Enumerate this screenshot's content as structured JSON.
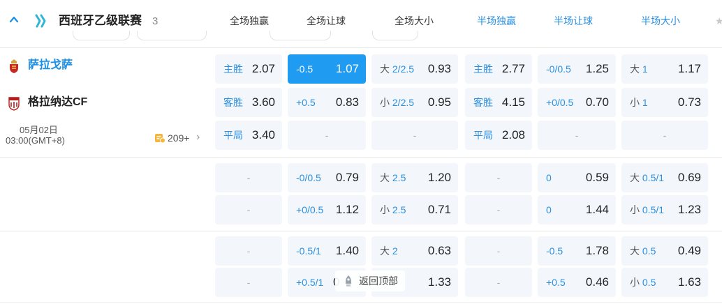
{
  "league": {
    "name": "西班牙乙级联赛",
    "count": "3"
  },
  "columns": [
    "全场独赢",
    "全场让球",
    "全场大小",
    "半场独赢",
    "半场让球",
    "半场大小"
  ],
  "match": {
    "home": "萨拉戈萨",
    "away": "格拉纳达CF",
    "date": "05月02日",
    "time": "03:00(GMT+8)",
    "more_count": "209+"
  },
  "odds": {
    "r1": {
      "c1": {
        "lbl": "主胜",
        "val": "2.07"
      },
      "c2": {
        "lbl": "-0.5",
        "val": "1.07"
      },
      "c3": {
        "pre": "大",
        "lbl": "2/2.5",
        "val": "0.93"
      },
      "c4": {
        "lbl": "主胜",
        "val": "2.77"
      },
      "c5": {
        "lbl": "-0/0.5",
        "val": "1.25"
      },
      "c6": {
        "pre": "大",
        "lbl": "1",
        "val": "1.17"
      }
    },
    "r2": {
      "c1": {
        "lbl": "客胜",
        "val": "3.60"
      },
      "c2": {
        "lbl": "+0.5",
        "val": "0.83"
      },
      "c3": {
        "pre": "小",
        "lbl": "2/2.5",
        "val": "0.95"
      },
      "c4": {
        "lbl": "客胜",
        "val": "4.15"
      },
      "c5": {
        "lbl": "+0/0.5",
        "val": "0.70"
      },
      "c6": {
        "pre": "小",
        "lbl": "1",
        "val": "0.73"
      }
    },
    "r3": {
      "c1": {
        "lbl": "平局",
        "val": "3.40"
      },
      "c4": {
        "lbl": "平局",
        "val": "2.08"
      }
    },
    "r4": {
      "c2": {
        "lbl": "-0/0.5",
        "val": "0.79"
      },
      "c3": {
        "pre": "大",
        "lbl": "2.5",
        "val": "1.20"
      },
      "c5": {
        "lbl": "0",
        "val": "0.59"
      },
      "c6": {
        "pre": "大",
        "lbl": "0.5/1",
        "val": "0.69"
      }
    },
    "r5": {
      "c2": {
        "lbl": "+0/0.5",
        "val": "1.12"
      },
      "c3": {
        "pre": "小",
        "lbl": "2.5",
        "val": "0.71"
      },
      "c5": {
        "lbl": "0",
        "val": "1.44"
      },
      "c6": {
        "pre": "小",
        "lbl": "0.5/1",
        "val": "1.23"
      }
    },
    "r6": {
      "c2": {
        "lbl": "-0.5/1",
        "val": "1.40"
      },
      "c3": {
        "pre": "大",
        "lbl": "2",
        "val": "0.63"
      },
      "c5": {
        "lbl": "-0.5",
        "val": "1.78"
      },
      "c6": {
        "pre": "大",
        "lbl": "0.5",
        "val": "0.49"
      }
    },
    "r7": {
      "c2": {
        "lbl": "+0.5/1",
        "val": "0"
      },
      "c3": {
        "val": "1.33"
      },
      "c5": {
        "lbl": "+0.5",
        "val": "0.46"
      },
      "c6": {
        "pre": "小",
        "lbl": "0.5",
        "val": "1.63"
      }
    }
  },
  "empty_placeholder": "-",
  "back_to_top": "返回顶部",
  "colors": {
    "accent": "#1f9cf2",
    "cell_bg": "#f3f7fc",
    "label_blue": "#2a8fe0"
  }
}
